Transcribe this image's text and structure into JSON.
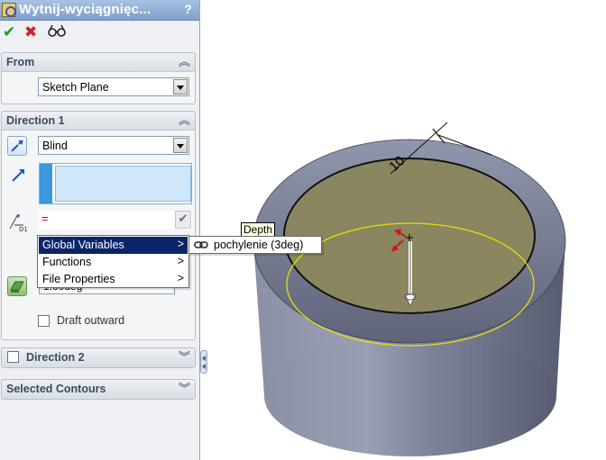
{
  "panel": {
    "title": "Wytnij-wyciągnięc...",
    "help": "?",
    "actions": {
      "ok": "✔",
      "cancel": "✖",
      "preview": "6ð"
    },
    "from": {
      "title": "From",
      "chevron": "︽",
      "combo_value": "Sketch Plane"
    },
    "direction1": {
      "title": "Direction 1",
      "chevron": "︽",
      "end_condition": "Blind",
      "depth_equation": "=",
      "angle_value": "1.00deg",
      "draft_outward_label": "Draft outward"
    },
    "direction2": {
      "title": "Direction 2",
      "chevron": "︾"
    },
    "selected_contours": {
      "title": "Selected Contours",
      "chevron": "︾"
    }
  },
  "context_menu": {
    "items": [
      {
        "label": "Global Variables",
        "arrow": ">"
      },
      {
        "label": "Functions",
        "arrow": ">"
      },
      {
        "label": "File Properties",
        "arrow": ">"
      }
    ],
    "submenu_item": "pochylenie (3deg)"
  },
  "tooltip": "Depth",
  "viewport": {
    "dimension_value": "10"
  },
  "colors": {
    "title_bar": "#8fabd5",
    "highlight": "#0a246a",
    "model_side": "#8d93a8",
    "model_top": "#8a8660",
    "sketch_profile": "#e8e000"
  }
}
